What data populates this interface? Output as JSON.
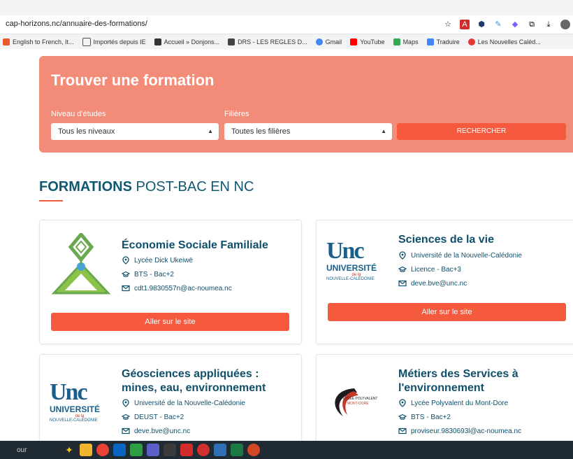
{
  "browser": {
    "url": "cap-horizons.nc/annuaire-des-formations/",
    "bookmarks": [
      "English to French, It...",
      "Importés depuis IE",
      "Accueil » Donjons...",
      "DRS - LES REGLES D...",
      "Gmail",
      "YouTube",
      "Maps",
      "Traduire",
      "Les Nouvelles Caléd..."
    ]
  },
  "search": {
    "title": "Trouver une formation",
    "level_label": "Niveau d'études",
    "level_value": "Tous les niveaux",
    "filiere_label": "Filières",
    "filiere_value": "Toutes les filières",
    "button": "RECHERCHER"
  },
  "section": {
    "title_bold": "FORMATIONS",
    "title_rest": " POST-BAC EN NC"
  },
  "cards": [
    {
      "title": "Économie Sociale Familiale",
      "school": "Lycée Dick Ukeiwë",
      "level": "BTS - Bac+2",
      "email": "cdt1.9830557n@ac-noumea.nc",
      "cta": "Aller sur le site"
    },
    {
      "title": "Sciences de la vie",
      "school": "Université de la Nouvelle-Calédonie",
      "level": "Licence - Bac+3",
      "email": "deve.bve@unc.nc",
      "cta": "Aller sur le site"
    },
    {
      "title_line1": "Géosciences appliquées :",
      "title_line2": "mines, eau, environnement",
      "school": "Université de la Nouvelle-Calédonie",
      "level": "DEUST - Bac+2",
      "email": "deve.bve@unc.nc"
    },
    {
      "title_line1": "Métiers des Services à",
      "title_line2": "l'environnement",
      "school": "Lycée Polyvalent du Mont-Dore",
      "level": "BTS - Bac+2",
      "email": "proviseur.9830693l@ac-noumea.nc"
    }
  ],
  "logos": {
    "unc_top": "Unc",
    "unc_university": "UNIVERSITÉ",
    "unc_de": "de la",
    "unc_nc": "NOUVELLE-CALÉDONIE",
    "lycee": "LYCÉE POLYVALENT",
    "montdore": "MONT-DORE"
  },
  "taskbar": {
    "text": "our"
  },
  "colors": {
    "hero": "#f28b78",
    "accent": "#f5593e",
    "title": "#0f5873"
  }
}
